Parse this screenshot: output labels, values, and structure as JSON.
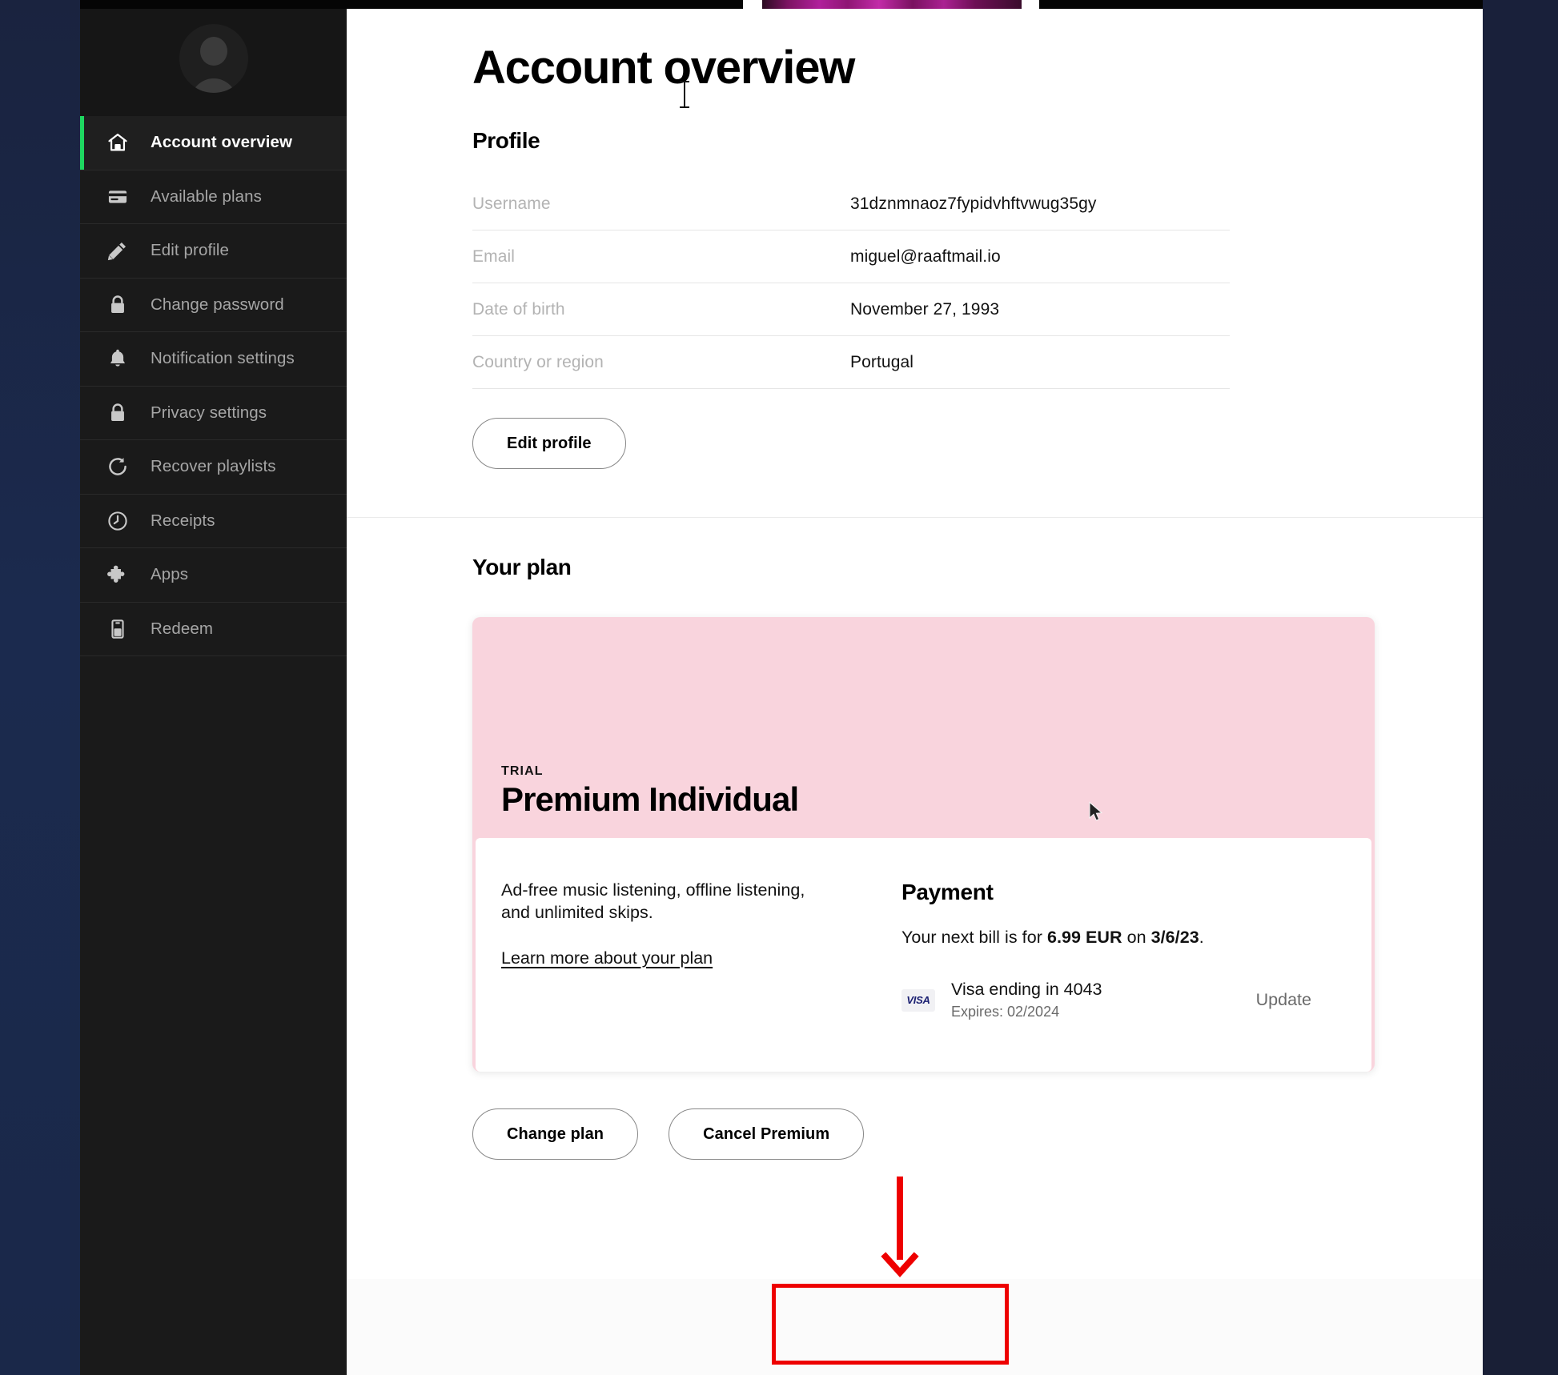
{
  "window": {
    "background_color": "#ffffff",
    "backdrop_color_left": "#1b2a4e",
    "backdrop_color_right": "#1a2139",
    "accent_color": "#1ed760",
    "annotation_color": "#ee0000",
    "plan_card_color": "#f9d4dd"
  },
  "sidebar": {
    "avatar_name": "avatar-placeholder",
    "items": [
      {
        "label": "Account overview",
        "icon": "home-icon",
        "active": true
      },
      {
        "label": "Available plans",
        "icon": "credit-card-icon",
        "active": false
      },
      {
        "label": "Edit profile",
        "icon": "pencil-icon",
        "active": false
      },
      {
        "label": "Change password",
        "icon": "lock-icon",
        "active": false
      },
      {
        "label": "Notification settings",
        "icon": "bell-icon",
        "active": false
      },
      {
        "label": "Privacy settings",
        "icon": "lock-icon",
        "active": false
      },
      {
        "label": "Recover playlists",
        "icon": "refresh-icon",
        "active": false
      },
      {
        "label": "Receipts",
        "icon": "clock-icon",
        "active": false
      },
      {
        "label": "Apps",
        "icon": "puzzle-piece-icon",
        "active": false
      },
      {
        "label": "Redeem",
        "icon": "gift-card-icon",
        "active": false
      }
    ]
  },
  "main": {
    "page_title": "Account overview",
    "profile": {
      "section_title": "Profile",
      "rows": [
        {
          "label": "Username",
          "value": "31dznmnaoz7fypidvhftvwug35gy"
        },
        {
          "label": "Email",
          "value": "miguel@raaftmail.io"
        },
        {
          "label": "Date of birth",
          "value": "November 27, 1993"
        },
        {
          "label": "Country or region",
          "value": "Portugal"
        }
      ],
      "edit_button": "Edit profile"
    },
    "plan": {
      "section_title": "Your plan",
      "badge": "TRIAL",
      "name": "Premium Individual",
      "description": "Ad-free music listening, offline listening, and unlimited skips.",
      "learn_more": "Learn more about your plan",
      "payment": {
        "title": "Payment",
        "next_bill_prefix": "Your next bill is for ",
        "next_bill_amount": "6.99 EUR",
        "next_bill_middle": " on ",
        "next_bill_date": "3/6/23",
        "next_bill_suffix": ".",
        "card_brand": "VISA",
        "card_name": "Visa ending in 4043",
        "card_expires": "Expires: 02/2024",
        "update_label": "Update"
      },
      "actions": {
        "change_plan": "Change plan",
        "cancel_premium": "Cancel Premium"
      }
    }
  }
}
